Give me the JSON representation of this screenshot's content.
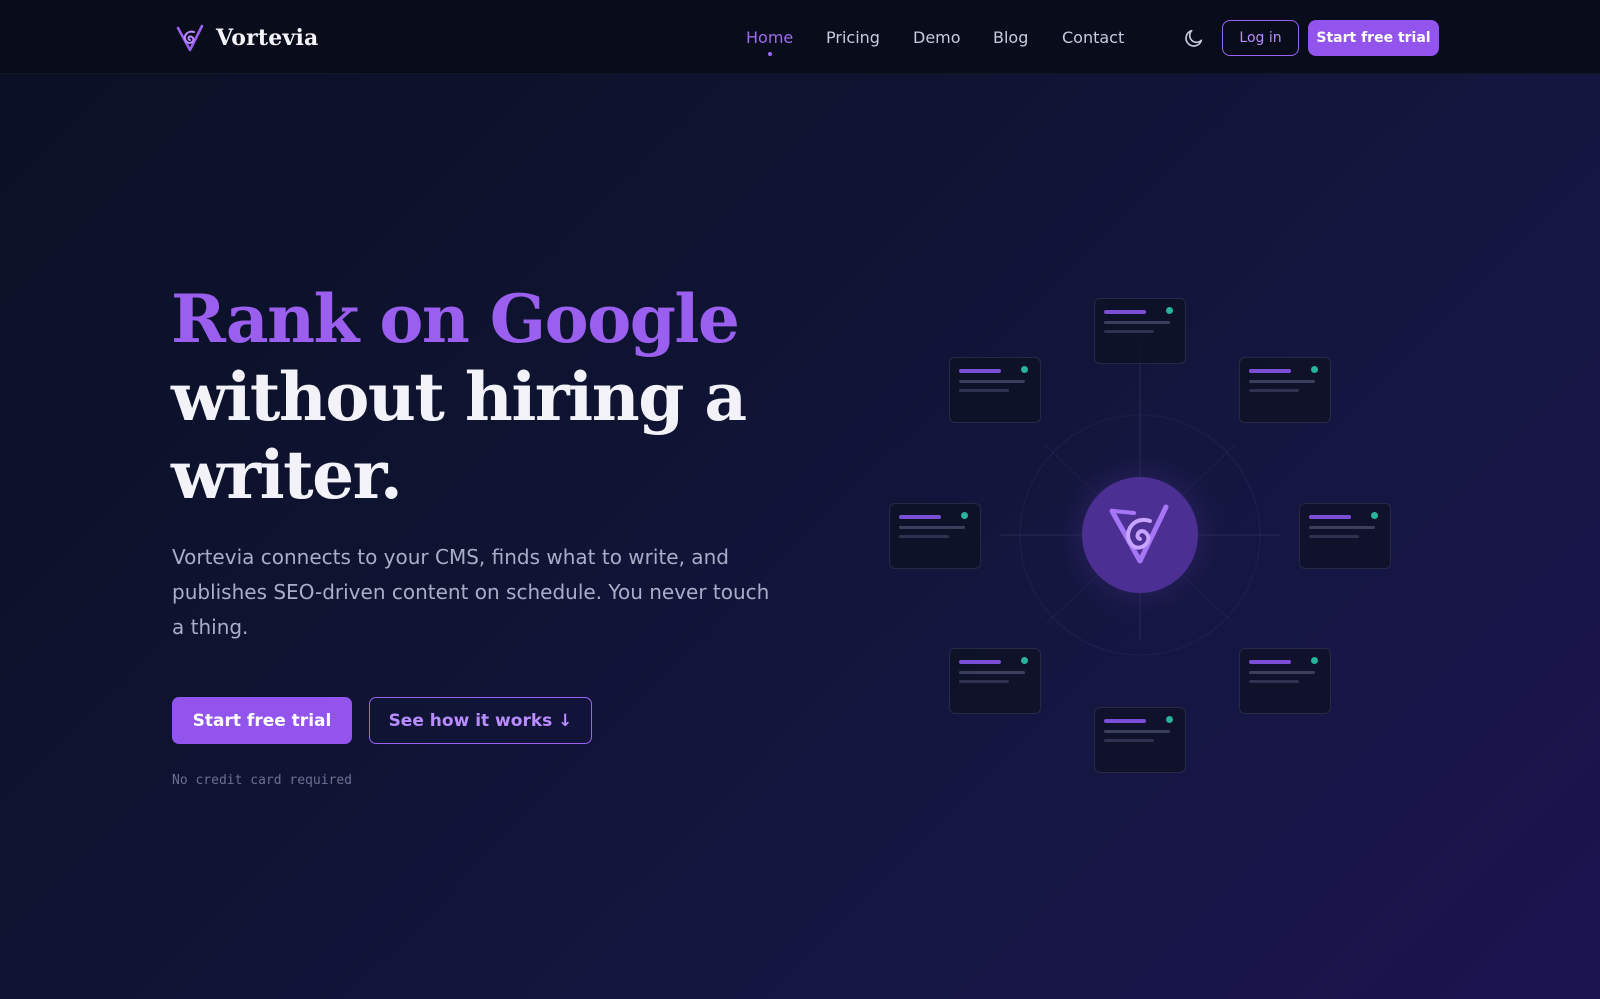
{
  "brand": {
    "name": "Vortevia",
    "logo_icon": "vortevia-v-swirl-logo",
    "accent_color": "#9254ec",
    "accent_text_color": "#9b5ff0",
    "status_dot_color": "#27b49a"
  },
  "nav": {
    "links": [
      {
        "label": "Home",
        "active": true
      },
      {
        "label": "Pricing",
        "active": false
      },
      {
        "label": "Demo",
        "active": false
      },
      {
        "label": "Blog",
        "active": false
      },
      {
        "label": "Contact",
        "active": false
      }
    ],
    "theme_toggle_icon": "moon-icon",
    "login_label": "Log in",
    "trial_label": "Start free trial"
  },
  "hero": {
    "title_accent": "Rank on Google",
    "title_rest": "without hiring a writer.",
    "subtitle": "Vortevia connects to your CMS, finds what to write, and publishes SEO-driven content on schedule. You never touch a thing.",
    "primary_cta": "Start free trial",
    "secondary_cta": "See how it works ↓",
    "note": "No credit card required"
  },
  "illustration": {
    "center_icon": "vortevia-v-swirl-logo",
    "card_count": 8
  }
}
